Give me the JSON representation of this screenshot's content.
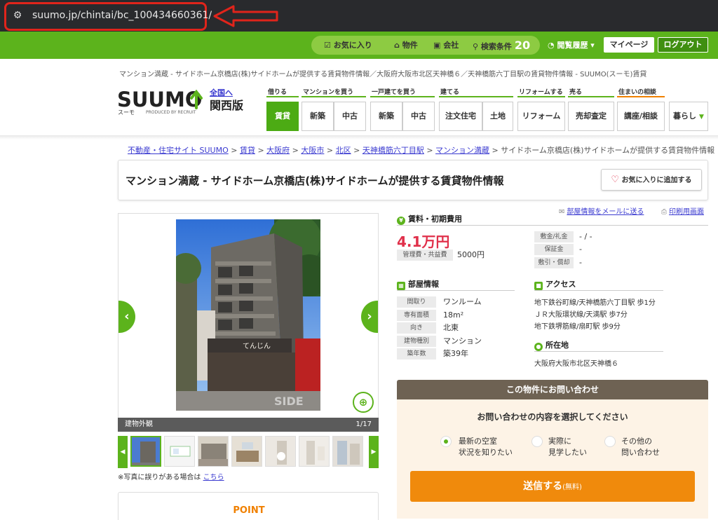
{
  "browser": {
    "url": "suumo.jp/chintai/bc_100434660361/"
  },
  "topbar": {
    "favorites": "お気に入り",
    "properties": "物件",
    "companies": "会社",
    "search_conditions": "検索条件",
    "search_count": "20",
    "history": "閲覧履歴",
    "mypage": "マイページ",
    "logout": "ログアウト"
  },
  "breadcrumb_top": "マンション満蔵 - サイドホーム京橋店(株)サイドホームが提供する賃貸物件情報／大阪府大阪市北区天神橋６／天神橋筋六丁目駅の賃貸物件情報 - SUUMO(スーモ)賃貸",
  "logo": {
    "text": "SUUMO",
    "kana": "スーモ",
    "produced": "PRODUCED BY RECRUIT",
    "national": "全国へ",
    "region": "関西版"
  },
  "categories": [
    {
      "label": "借りる"
    },
    {
      "label": "マンションを買う"
    },
    {
      "label": "一戸建てを買う"
    },
    {
      "label": "建てる"
    },
    {
      "label": "リフォームする"
    },
    {
      "label": "売る"
    },
    {
      "label": "住まいの相談"
    }
  ],
  "tabs": [
    {
      "label": "賃貸"
    },
    {
      "label": "新築"
    },
    {
      "label": "中古"
    },
    {
      "label": "新築"
    },
    {
      "label": "中古"
    },
    {
      "label": "注文住宅"
    },
    {
      "label": "土地"
    },
    {
      "label": "リフォーム"
    },
    {
      "label": "売却査定"
    },
    {
      "label": "講座/相談"
    },
    {
      "label": "暮らし"
    }
  ],
  "breadcrumb": {
    "items": [
      "不動産・住宅サイト SUUMO",
      "賃貸",
      "大阪府",
      "大阪市",
      "北区",
      "天神橋筋六丁目駅",
      "マンション満蔵"
    ],
    "current": "サイドホーム京橋店(株)サイドホームが提供する賃貸物件情報",
    "sep": " > "
  },
  "title": "マンション満蔵 - サイドホーム京橋店(株)サイドホームが提供する賃貸物件情報",
  "fav_button": "お気に入りに追加する",
  "photo": {
    "caption": "建物外観",
    "counter": "1/17",
    "sign_text": "てんじん",
    "watermark": "SIDE"
  },
  "photo_note": {
    "text": "※写真に誤りがある場合は",
    "link": "こちら"
  },
  "point_title": "POINT",
  "links": {
    "email": "部屋情報をメールに送る",
    "print": "印刷用画面"
  },
  "rent_section": {
    "heading": "賃料・初期費用",
    "rent": "4.1万円",
    "mgmt_label": "管理費・共益費",
    "mgmt_value": "5000円",
    "deposit_label": "敷金/礼金",
    "deposit_value": "- / -",
    "guarantee_label": "保証金",
    "guarantee_value": "-",
    "shikibiki_label": "敷引・償却",
    "shikibiki_value": "-"
  },
  "room_info": {
    "heading": "部屋情報",
    "rows": [
      {
        "label": "間取り",
        "value": "ワンルーム"
      },
      {
        "label": "専有面積",
        "value": "18m²"
      },
      {
        "label": "向き",
        "value": "北東"
      },
      {
        "label": "建物種別",
        "value": "マンション"
      },
      {
        "label": "築年数",
        "value": "築39年"
      }
    ]
  },
  "access": {
    "heading": "アクセス",
    "lines": [
      "地下鉄谷町線/天神橋筋六丁目駅 歩1分",
      "ＪＲ大阪環状線/天満駅 歩7分",
      "地下鉄堺筋線/扇町駅 歩9分"
    ]
  },
  "location": {
    "heading": "所在地",
    "address": "大阪府大阪市北区天神橋６"
  },
  "inquiry": {
    "heading": "この物件にお問い合わせ",
    "question": "お問い合わせの内容を選択してください",
    "options": [
      {
        "line1": "最新の空室",
        "line2": "状況を知りたい"
      },
      {
        "line1": "実際に",
        "line2": "見学したい"
      },
      {
        "line1": "その他の",
        "line2": "問い合わせ"
      }
    ],
    "send": "送信する",
    "send_note": "(無料)"
  },
  "colors": {
    "suumo_green": "#5cb31c",
    "rent_red": "#e0304a",
    "send_orange": "#f08a0c",
    "url_highlight": "#e0241b"
  }
}
